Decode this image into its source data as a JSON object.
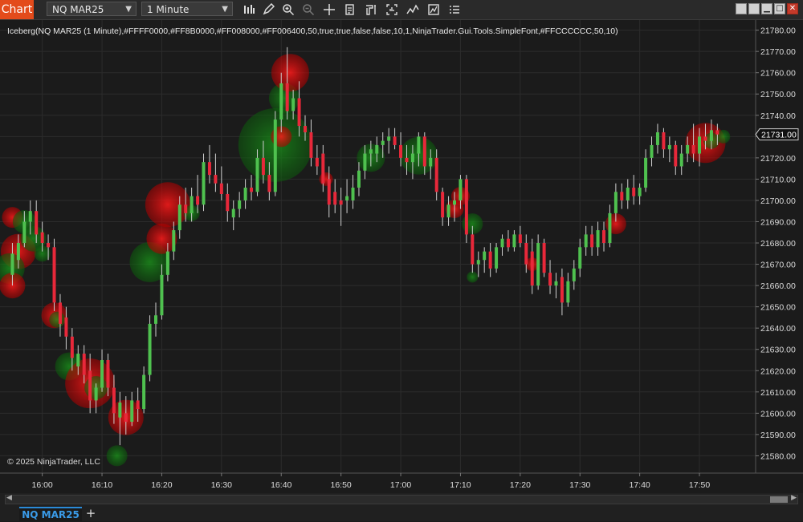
{
  "toolbar": {
    "chart_label": "Chart",
    "instrument": "NQ MAR25",
    "interval": "1 Minute"
  },
  "tabs": {
    "active": "NQ MAR25",
    "add": "+"
  },
  "colors": {
    "background": "#1b1b1b",
    "up_candle": "#4fc14f",
    "down_candle": "#e8283a",
    "bubble_red": "#ff0000",
    "bubble_green": "#008000",
    "accent_orange": "#e34b1b",
    "tab_blue": "#3a9be8"
  },
  "chart_data": {
    "type": "candlestick",
    "indicator_label": "Iceberg(NQ MAR25 (1 Minute),#FFFF0000,#FF8B0000,#FF008000,#FF006400,50,true,true,false,false,10,1,NinjaTrader.Gui.Tools.SimpleFont,#FFCCCCCC,50,10)",
    "copyright": "© 2025 NinjaTrader, LLC",
    "last_price": "21731.00",
    "ylim": [
      21573,
      21784
    ],
    "xlim_minutes_from_1554": [
      0,
      125
    ],
    "y_ticks": [
      "21580.00",
      "21590.00",
      "21600.00",
      "21610.00",
      "21620.00",
      "21630.00",
      "21640.00",
      "21650.00",
      "21660.00",
      "21670.00",
      "21680.00",
      "21690.00",
      "21700.00",
      "21710.00",
      "21720.00",
      "21730.00",
      "21740.00",
      "21750.00",
      "21760.00",
      "21770.00",
      "21780.00"
    ],
    "x_ticks": [
      {
        "t": 6,
        "label": "16:00"
      },
      {
        "t": 16,
        "label": "16:10"
      },
      {
        "t": 26,
        "label": "16:20"
      },
      {
        "t": 36,
        "label": "16:30"
      },
      {
        "t": 46,
        "label": "16:40"
      },
      {
        "t": 56,
        "label": "16:50"
      },
      {
        "t": 66,
        "label": "17:00"
      },
      {
        "t": 76,
        "label": "17:10"
      },
      {
        "t": 86,
        "label": "17:20"
      },
      {
        "t": 96,
        "label": "17:30"
      },
      {
        "t": 106,
        "label": "17:40"
      },
      {
        "t": 116,
        "label": "17:50"
      }
    ],
    "candles": [
      {
        "t": 1,
        "o": 21665,
        "h": 21680,
        "l": 21660,
        "c": 21675
      },
      {
        "t": 2,
        "o": 21672,
        "h": 21684,
        "l": 21668,
        "c": 21680
      },
      {
        "t": 3,
        "o": 21680,
        "h": 21695,
        "l": 21678,
        "c": 21690
      },
      {
        "t": 4,
        "o": 21690,
        "h": 21700,
        "l": 21684,
        "c": 21695
      },
      {
        "t": 5,
        "o": 21695,
        "h": 21700,
        "l": 21680,
        "c": 21684
      },
      {
        "t": 6,
        "o": 21685,
        "h": 21690,
        "l": 21676,
        "c": 21680
      },
      {
        "t": 7,
        "o": 21680,
        "h": 21684,
        "l": 21672,
        "c": 21678
      },
      {
        "t": 8,
        "o": 21678,
        "h": 21682,
        "l": 21648,
        "c": 21652
      },
      {
        "t": 9,
        "o": 21652,
        "h": 21656,
        "l": 21636,
        "c": 21642
      },
      {
        "t": 10,
        "o": 21645,
        "h": 21650,
        "l": 21630,
        "c": 21636
      },
      {
        "t": 11,
        "o": 21636,
        "h": 21640,
        "l": 21620,
        "c": 21626
      },
      {
        "t": 12,
        "o": 21622,
        "h": 21632,
        "l": 21618,
        "c": 21628
      },
      {
        "t": 13,
        "o": 21628,
        "h": 21632,
        "l": 21614,
        "c": 21618
      },
      {
        "t": 14,
        "o": 21620,
        "h": 21628,
        "l": 21600,
        "c": 21606
      },
      {
        "t": 15,
        "o": 21606,
        "h": 21614,
        "l": 21600,
        "c": 21612
      },
      {
        "t": 16,
        "o": 21612,
        "h": 21630,
        "l": 21610,
        "c": 21625
      },
      {
        "t": 17,
        "o": 21625,
        "h": 21628,
        "l": 21608,
        "c": 21612
      },
      {
        "t": 18,
        "o": 21612,
        "h": 21618,
        "l": 21595,
        "c": 21600
      },
      {
        "t": 19,
        "o": 21598,
        "h": 21610,
        "l": 21585,
        "c": 21605
      },
      {
        "t": 20,
        "o": 21600,
        "h": 21608,
        "l": 21590,
        "c": 21596
      },
      {
        "t": 21,
        "o": 21596,
        "h": 21610,
        "l": 21594,
        "c": 21606
      },
      {
        "t": 22,
        "o": 21606,
        "h": 21612,
        "l": 21596,
        "c": 21602
      },
      {
        "t": 23,
        "o": 21602,
        "h": 21622,
        "l": 21600,
        "c": 21618
      },
      {
        "t": 24,
        "o": 21618,
        "h": 21646,
        "l": 21615,
        "c": 21642
      },
      {
        "t": 25,
        "o": 21642,
        "h": 21652,
        "l": 21636,
        "c": 21646
      },
      {
        "t": 26,
        "o": 21646,
        "h": 21670,
        "l": 21644,
        "c": 21665
      },
      {
        "t": 27,
        "o": 21665,
        "h": 21680,
        "l": 21662,
        "c": 21676
      },
      {
        "t": 28,
        "o": 21676,
        "h": 21690,
        "l": 21672,
        "c": 21686
      },
      {
        "t": 29,
        "o": 21686,
        "h": 21702,
        "l": 21682,
        "c": 21698
      },
      {
        "t": 30,
        "o": 21698,
        "h": 21706,
        "l": 21690,
        "c": 21694
      },
      {
        "t": 31,
        "o": 21694,
        "h": 21706,
        "l": 21690,
        "c": 21702
      },
      {
        "t": 32,
        "o": 21702,
        "h": 21712,
        "l": 21694,
        "c": 21698
      },
      {
        "t": 33,
        "o": 21698,
        "h": 21722,
        "l": 21695,
        "c": 21718
      },
      {
        "t": 34,
        "o": 21718,
        "h": 21726,
        "l": 21708,
        "c": 21712
      },
      {
        "t": 35,
        "o": 21712,
        "h": 21722,
        "l": 21704,
        "c": 21708
      },
      {
        "t": 36,
        "o": 21708,
        "h": 21716,
        "l": 21700,
        "c": 21703
      },
      {
        "t": 37,
        "o": 21703,
        "h": 21708,
        "l": 21690,
        "c": 21695
      },
      {
        "t": 38,
        "o": 21692,
        "h": 21700,
        "l": 21686,
        "c": 21696
      },
      {
        "t": 39,
        "o": 21696,
        "h": 21704,
        "l": 21692,
        "c": 21700
      },
      {
        "t": 40,
        "o": 21700,
        "h": 21710,
        "l": 21696,
        "c": 21706
      },
      {
        "t": 41,
        "o": 21706,
        "h": 21712,
        "l": 21700,
        "c": 21704
      },
      {
        "t": 42,
        "o": 21704,
        "h": 21724,
        "l": 21702,
        "c": 21720
      },
      {
        "t": 43,
        "o": 21720,
        "h": 21728,
        "l": 21708,
        "c": 21712
      },
      {
        "t": 44,
        "o": 21712,
        "h": 21718,
        "l": 21700,
        "c": 21704
      },
      {
        "t": 45,
        "o": 21704,
        "h": 21742,
        "l": 21702,
        "c": 21738
      },
      {
        "t": 46,
        "o": 21738,
        "h": 21760,
        "l": 21732,
        "c": 21755
      },
      {
        "t": 47,
        "o": 21755,
        "h": 21772,
        "l": 21738,
        "c": 21742
      },
      {
        "t": 48,
        "o": 21742,
        "h": 21752,
        "l": 21738,
        "c": 21748
      },
      {
        "t": 49,
        "o": 21748,
        "h": 21756,
        "l": 21730,
        "c": 21735
      },
      {
        "t": 50,
        "o": 21735,
        "h": 21740,
        "l": 21728,
        "c": 21732
      },
      {
        "t": 51,
        "o": 21732,
        "h": 21738,
        "l": 21716,
        "c": 21720
      },
      {
        "t": 52,
        "o": 21720,
        "h": 21726,
        "l": 21712,
        "c": 21716
      },
      {
        "t": 53,
        "o": 21722,
        "h": 21726,
        "l": 21704,
        "c": 21708
      },
      {
        "t": 54,
        "o": 21710,
        "h": 21716,
        "l": 21692,
        "c": 21698
      },
      {
        "t": 55,
        "o": 21704,
        "h": 21710,
        "l": 21694,
        "c": 21698
      },
      {
        "t": 56,
        "o": 21700,
        "h": 21706,
        "l": 21688,
        "c": 21698
      },
      {
        "t": 57,
        "o": 21700,
        "h": 21710,
        "l": 21694,
        "c": 21702
      },
      {
        "t": 58,
        "o": 21700,
        "h": 21712,
        "l": 21696,
        "c": 21706
      },
      {
        "t": 59,
        "o": 21706,
        "h": 21718,
        "l": 21702,
        "c": 21714
      },
      {
        "t": 60,
        "o": 21714,
        "h": 21726,
        "l": 21710,
        "c": 21722
      },
      {
        "t": 61,
        "o": 21722,
        "h": 21728,
        "l": 21716,
        "c": 21724
      },
      {
        "t": 62,
        "o": 21722,
        "h": 21730,
        "l": 21718,
        "c": 21726
      },
      {
        "t": 63,
        "o": 21726,
        "h": 21732,
        "l": 21720,
        "c": 21728
      },
      {
        "t": 64,
        "o": 21728,
        "h": 21734,
        "l": 21722,
        "c": 21730
      },
      {
        "t": 65,
        "o": 21730,
        "h": 21734,
        "l": 21724,
        "c": 21726
      },
      {
        "t": 66,
        "o": 21726,
        "h": 21732,
        "l": 21716,
        "c": 21720
      },
      {
        "t": 67,
        "o": 21720,
        "h": 21726,
        "l": 21712,
        "c": 21718
      },
      {
        "t": 68,
        "o": 21718,
        "h": 21726,
        "l": 21710,
        "c": 21722
      },
      {
        "t": 69,
        "o": 21722,
        "h": 21732,
        "l": 21716,
        "c": 21730
      },
      {
        "t": 70,
        "o": 21730,
        "h": 21732,
        "l": 21712,
        "c": 21716
      },
      {
        "t": 71,
        "o": 21716,
        "h": 21724,
        "l": 21710,
        "c": 21720
      },
      {
        "t": 72,
        "o": 21720,
        "h": 21724,
        "l": 21700,
        "c": 21704
      },
      {
        "t": 73,
        "o": 21704,
        "h": 21706,
        "l": 21688,
        "c": 21692
      },
      {
        "t": 74,
        "o": 21692,
        "h": 21702,
        "l": 21688,
        "c": 21698
      },
      {
        "t": 75,
        "o": 21698,
        "h": 21704,
        "l": 21690,
        "c": 21700
      },
      {
        "t": 76,
        "o": 21700,
        "h": 21712,
        "l": 21696,
        "c": 21710
      },
      {
        "t": 77,
        "o": 21710,
        "h": 21712,
        "l": 21680,
        "c": 21684
      },
      {
        "t": 78,
        "o": 21684,
        "h": 21688,
        "l": 21666,
        "c": 21670
      },
      {
        "t": 79,
        "o": 21670,
        "h": 21676,
        "l": 21664,
        "c": 21672
      },
      {
        "t": 80,
        "o": 21672,
        "h": 21678,
        "l": 21666,
        "c": 21676
      },
      {
        "t": 81,
        "o": 21676,
        "h": 21680,
        "l": 21664,
        "c": 21668
      },
      {
        "t": 82,
        "o": 21668,
        "h": 21680,
        "l": 21666,
        "c": 21678
      },
      {
        "t": 83,
        "o": 21678,
        "h": 21684,
        "l": 21674,
        "c": 21682
      },
      {
        "t": 84,
        "o": 21682,
        "h": 21686,
        "l": 21676,
        "c": 21678
      },
      {
        "t": 85,
        "o": 21678,
        "h": 21686,
        "l": 21676,
        "c": 21684
      },
      {
        "t": 86,
        "o": 21684,
        "h": 21688,
        "l": 21678,
        "c": 21680
      },
      {
        "t": 87,
        "o": 21680,
        "h": 21684,
        "l": 21666,
        "c": 21670
      },
      {
        "t": 88,
        "o": 21676,
        "h": 21682,
        "l": 21656,
        "c": 21660
      },
      {
        "t": 89,
        "o": 21660,
        "h": 21684,
        "l": 21658,
        "c": 21680
      },
      {
        "t": 90,
        "o": 21680,
        "h": 21682,
        "l": 21664,
        "c": 21666
      },
      {
        "t": 91,
        "o": 21666,
        "h": 21672,
        "l": 21656,
        "c": 21660
      },
      {
        "t": 92,
        "o": 21660,
        "h": 21666,
        "l": 21654,
        "c": 21662
      },
      {
        "t": 93,
        "o": 21664,
        "h": 21668,
        "l": 21646,
        "c": 21652
      },
      {
        "t": 94,
        "o": 21652,
        "h": 21666,
        "l": 21650,
        "c": 21662
      },
      {
        "t": 95,
        "o": 21662,
        "h": 21672,
        "l": 21658,
        "c": 21668
      },
      {
        "t": 96,
        "o": 21668,
        "h": 21682,
        "l": 21664,
        "c": 21678
      },
      {
        "t": 97,
        "o": 21678,
        "h": 21688,
        "l": 21674,
        "c": 21684
      },
      {
        "t": 98,
        "o": 21684,
        "h": 21688,
        "l": 21674,
        "c": 21678
      },
      {
        "t": 99,
        "o": 21678,
        "h": 21690,
        "l": 21674,
        "c": 21686
      },
      {
        "t": 100,
        "o": 21686,
        "h": 21690,
        "l": 21676,
        "c": 21680
      },
      {
        "t": 101,
        "o": 21680,
        "h": 21698,
        "l": 21678,
        "c": 21694
      },
      {
        "t": 102,
        "o": 21694,
        "h": 21708,
        "l": 21690,
        "c": 21704
      },
      {
        "t": 103,
        "o": 21704,
        "h": 21708,
        "l": 21696,
        "c": 21700
      },
      {
        "t": 104,
        "o": 21700,
        "h": 21710,
        "l": 21696,
        "c": 21706
      },
      {
        "t": 105,
        "o": 21706,
        "h": 21712,
        "l": 21698,
        "c": 21702
      },
      {
        "t": 106,
        "o": 21702,
        "h": 21708,
        "l": 21698,
        "c": 21706
      },
      {
        "t": 107,
        "o": 21706,
        "h": 21724,
        "l": 21704,
        "c": 21720
      },
      {
        "t": 108,
        "o": 21720,
        "h": 21730,
        "l": 21716,
        "c": 21726
      },
      {
        "t": 109,
        "o": 21726,
        "h": 21736,
        "l": 21722,
        "c": 21732
      },
      {
        "t": 110,
        "o": 21732,
        "h": 21734,
        "l": 21720,
        "c": 21724
      },
      {
        "t": 111,
        "o": 21724,
        "h": 21730,
        "l": 21718,
        "c": 21726
      },
      {
        "t": 112,
        "o": 21726,
        "h": 21728,
        "l": 21712,
        "c": 21716
      },
      {
        "t": 113,
        "o": 21716,
        "h": 21726,
        "l": 21712,
        "c": 21722
      },
      {
        "t": 114,
        "o": 21722,
        "h": 21730,
        "l": 21718,
        "c": 21726
      },
      {
        "t": 115,
        "o": 21726,
        "h": 21736,
        "l": 21718,
        "c": 21722
      },
      {
        "t": 116,
        "o": 21722,
        "h": 21734,
        "l": 21716,
        "c": 21730
      },
      {
        "t": 117,
        "o": 21730,
        "h": 21736,
        "l": 21724,
        "c": 21728
      },
      {
        "t": 118,
        "o": 21728,
        "h": 21738,
        "l": 21724,
        "c": 21733
      },
      {
        "t": 119,
        "o": 21733,
        "h": 21736,
        "l": 21726,
        "c": 21731
      }
    ],
    "bubbles": [
      {
        "t": 1,
        "y": 21692,
        "size": 6,
        "side": "sell"
      },
      {
        "t": 2,
        "y": 21676,
        "size": 12,
        "side": "sell"
      },
      {
        "t": 0.5,
        "y": 21668,
        "size": 10,
        "side": "buy"
      },
      {
        "t": 1,
        "y": 21660,
        "size": 8,
        "side": "sell"
      },
      {
        "t": 3,
        "y": 21690,
        "size": 7,
        "side": "buy"
      },
      {
        "t": 4.5,
        "y": 21682,
        "size": 8,
        "side": "buy"
      },
      {
        "t": 6,
        "y": 21675,
        "size": 4,
        "side": "buy"
      },
      {
        "t": 8,
        "y": 21646,
        "size": 8,
        "side": "sell"
      },
      {
        "t": 8.5,
        "y": 21644,
        "size": 4,
        "side": "buy"
      },
      {
        "t": 10.5,
        "y": 21622,
        "size": 9,
        "side": "buy"
      },
      {
        "t": 14,
        "y": 21614,
        "size": 18,
        "side": "sell"
      },
      {
        "t": 15,
        "y": 21612,
        "size": 7,
        "side": "buy"
      },
      {
        "t": 18.5,
        "y": 21580,
        "size": 6,
        "side": "buy"
      },
      {
        "t": 20,
        "y": 21598,
        "size": 12,
        "side": "sell"
      },
      {
        "t": 24,
        "y": 21671,
        "size": 14,
        "side": "buy"
      },
      {
        "t": 26,
        "y": 21682,
        "size": 10,
        "side": "sell"
      },
      {
        "t": 27,
        "y": 21698,
        "size": 16,
        "side": "sell"
      },
      {
        "t": 31,
        "y": 21694,
        "size": 4,
        "side": "buy"
      },
      {
        "t": 45,
        "y": 21726,
        "size": 28,
        "side": "buy"
      },
      {
        "t": 46,
        "y": 21730,
        "size": 6,
        "side": "sell"
      },
      {
        "t": 46.5,
        "y": 21748,
        "size": 10,
        "side": "buy"
      },
      {
        "t": 47.5,
        "y": 21760,
        "size": 13,
        "side": "sell"
      },
      {
        "t": 53.5,
        "y": 21710,
        "size": 3,
        "side": "sell"
      },
      {
        "t": 61,
        "y": 21720,
        "size": 9,
        "side": "buy"
      },
      {
        "t": 69,
        "y": 21721,
        "size": 13,
        "side": "buy"
      },
      {
        "t": 76,
        "y": 21702,
        "size": 5,
        "side": "sell"
      },
      {
        "t": 75,
        "y": 21696,
        "size": 5,
        "side": "sell"
      },
      {
        "t": 78,
        "y": 21689,
        "size": 6,
        "side": "buy"
      },
      {
        "t": 78,
        "y": 21664,
        "size": 2,
        "side": "buy"
      },
      {
        "t": 88,
        "y": 21670,
        "size": 3,
        "side": "sell"
      },
      {
        "t": 102,
        "y": 21689,
        "size": 6,
        "side": "sell"
      },
      {
        "t": 117,
        "y": 21727,
        "size": 14,
        "side": "sell"
      },
      {
        "t": 118,
        "y": 21728,
        "size": 4,
        "side": "buy"
      },
      {
        "t": 120,
        "y": 21730,
        "size": 3,
        "side": "buy"
      }
    ]
  }
}
